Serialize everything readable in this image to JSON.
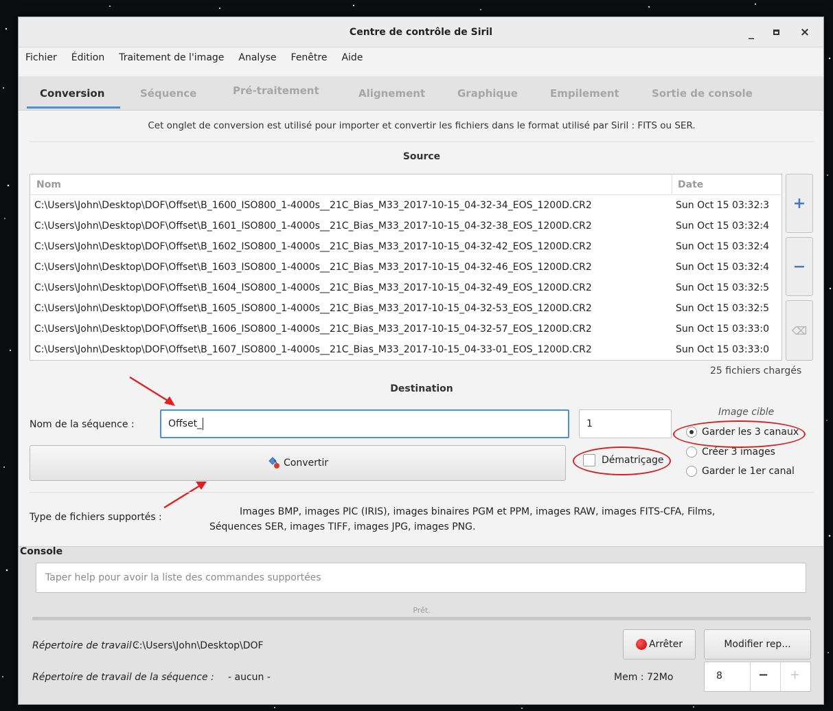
{
  "window": {
    "title": "Centre de contrôle de Siril",
    "minimize_glyph": "_",
    "close_glyph": "×"
  },
  "menu": [
    "Fichier",
    "Édition",
    "Traitement de l'image",
    "Analyse",
    "Fenêtre",
    "Aide"
  ],
  "tabs": [
    "Conversion",
    "Séquence",
    "Pré-traitement",
    "Alignement",
    "Graphique",
    "Empilement",
    "Sortie de console"
  ],
  "active_tab": "Conversion",
  "info_text": "Cet onglet de conversion est utilisé pour importer et convertir les fichiers dans le format utilisé par Siril : FITS ou SER.",
  "source": {
    "heading": "Source",
    "columns": [
      "Nom",
      "Date"
    ],
    "rows": [
      {
        "name": "C:\\Users\\John\\Desktop\\DOF\\Offset\\B_1600_ISO800_1-4000s__21C_Bias_M33_2017-10-15_04-32-34_EOS_1200D.CR2",
        "date": "Sun Oct 15 03:32:3"
      },
      {
        "name": "C:\\Users\\John\\Desktop\\DOF\\Offset\\B_1601_ISO800_1-4000s__21C_Bias_M33_2017-10-15_04-32-38_EOS_1200D.CR2",
        "date": "Sun Oct 15 03:32:4"
      },
      {
        "name": "C:\\Users\\John\\Desktop\\DOF\\Offset\\B_1602_ISO800_1-4000s__21C_Bias_M33_2017-10-15_04-32-42_EOS_1200D.CR2",
        "date": "Sun Oct 15 03:32:4"
      },
      {
        "name": "C:\\Users\\John\\Desktop\\DOF\\Offset\\B_1603_ISO800_1-4000s__21C_Bias_M33_2017-10-15_04-32-46_EOS_1200D.CR2",
        "date": "Sun Oct 15 03:32:4"
      },
      {
        "name": "C:\\Users\\John\\Desktop\\DOF\\Offset\\B_1604_ISO800_1-4000s__21C_Bias_M33_2017-10-15_04-32-49_EOS_1200D.CR2",
        "date": "Sun Oct 15 03:32:5"
      },
      {
        "name": "C:\\Users\\John\\Desktop\\DOF\\Offset\\B_1605_ISO800_1-4000s__21C_Bias_M33_2017-10-15_04-32-53_EOS_1200D.CR2",
        "date": "Sun Oct 15 03:32:5"
      },
      {
        "name": "C:\\Users\\John\\Desktop\\DOF\\Offset\\B_1606_ISO800_1-4000s__21C_Bias_M33_2017-10-15_04-32-57_EOS_1200D.CR2",
        "date": "Sun Oct 15 03:33:0"
      },
      {
        "name": "C:\\Users\\John\\Desktop\\DOF\\Offset\\B_1607_ISO800_1-4000s__21C_Bias_M33_2017-10-15_04-33-01_EOS_1200D.CR2",
        "date": "Sun Oct 15 03:33:0"
      }
    ],
    "file_count": "25 fichiers chargés",
    "add_glyph": "+",
    "remove_glyph": "−",
    "clear_glyph": "⌫"
  },
  "destination": {
    "heading": "Destination",
    "sequence_label": "Nom de la séquence :",
    "sequence_value": "Offset_",
    "start_index": "1",
    "convert_label": "Convertir",
    "debayer_label": "Dématriçage",
    "target_title": "Image cible",
    "radio_options": [
      "Garder les 3 canaux",
      "Créer 3 images",
      "Garder le 1er canal"
    ],
    "radio_selected": "Garder les 3 canaux"
  },
  "supported": {
    "label": "Type de fichiers supportés :",
    "line1": "Images BMP, images PIC (IRIS), images binaires PGM et PPM, images RAW, images FITS-CFA, Films,",
    "line2": "Séquences SER, images TIFF, images JPG, images PNG."
  },
  "console": {
    "heading": "Console",
    "placeholder": "Taper help pour avoir la liste des commandes supportées",
    "status": "Prêt."
  },
  "footer": {
    "workdir_label": "Répertoire de travail :",
    "workdir_value": "C:\\Users\\John\\Desktop\\DOF",
    "seq_workdir_label": "Répertoire de travail de la séquence :",
    "seq_workdir_value": "- aucun -",
    "stop_label": "Arrêter",
    "modify_label": "Modifier rep...",
    "mem_label": "Mem : 72Mo",
    "threads_value": "8",
    "minus_glyph": "−",
    "plus_glyph": "+"
  },
  "colors": {
    "annotation_red": "#d42323",
    "accent_blue": "#4a90d9",
    "stop_red": "#d10000"
  }
}
